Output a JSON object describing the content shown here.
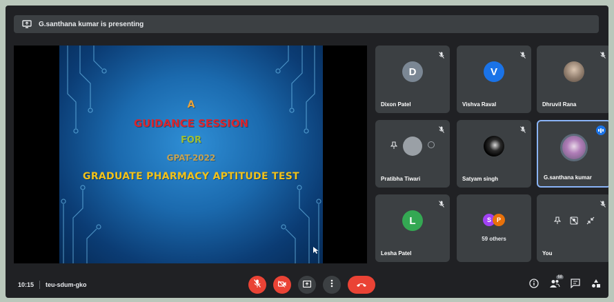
{
  "presenting_bar": {
    "text": "G.santhana kumar is presenting"
  },
  "slide": {
    "line1": "A",
    "line2": "GUIDANCE SESSION",
    "line3": "FOR",
    "line4": "GPAT-2022",
    "line5": "GRADUATE PHARMACY APTITUDE TEST"
  },
  "participants": [
    {
      "name": "Dixon Patel",
      "initial": "D",
      "color": "#7b8794",
      "avatar": "initial"
    },
    {
      "name": "Vishva Raval",
      "initial": "V",
      "color": "#1a73e8",
      "avatar": "initial"
    },
    {
      "name": "Dhruvil Rana",
      "initial": "",
      "color": "",
      "avatar": "photo"
    },
    {
      "name": "Pratibha Tiwari",
      "initial": "",
      "color": "",
      "avatar": "grey"
    },
    {
      "name": "Satyam singh",
      "initial": "",
      "color": "",
      "avatar": "dark"
    },
    {
      "name": "G.santhana kumar",
      "initial": "",
      "color": "",
      "avatar": "ring",
      "speaking": true
    },
    {
      "name": "Lesha Patel",
      "initial": "L",
      "color": "#34a853",
      "avatar": "initial"
    },
    {
      "name": "59 others",
      "initials": [
        "S",
        "P"
      ],
      "colors": [
        "#a142f4",
        "#e8710a"
      ]
    },
    {
      "name": "You"
    }
  ],
  "meeting": {
    "time": "10:15",
    "code": "teu-sdum-gko"
  },
  "people_count": "68",
  "icons": {
    "presenting": "present-screen-icon",
    "mic_off": "mic-off-icon",
    "cam_off": "camera-off-icon",
    "present": "present-now-icon",
    "more": "more-options-icon",
    "end_call": "end-call-icon",
    "info": "info-icon",
    "people": "people-icon",
    "chat": "chat-icon",
    "activities": "activities-icon"
  }
}
